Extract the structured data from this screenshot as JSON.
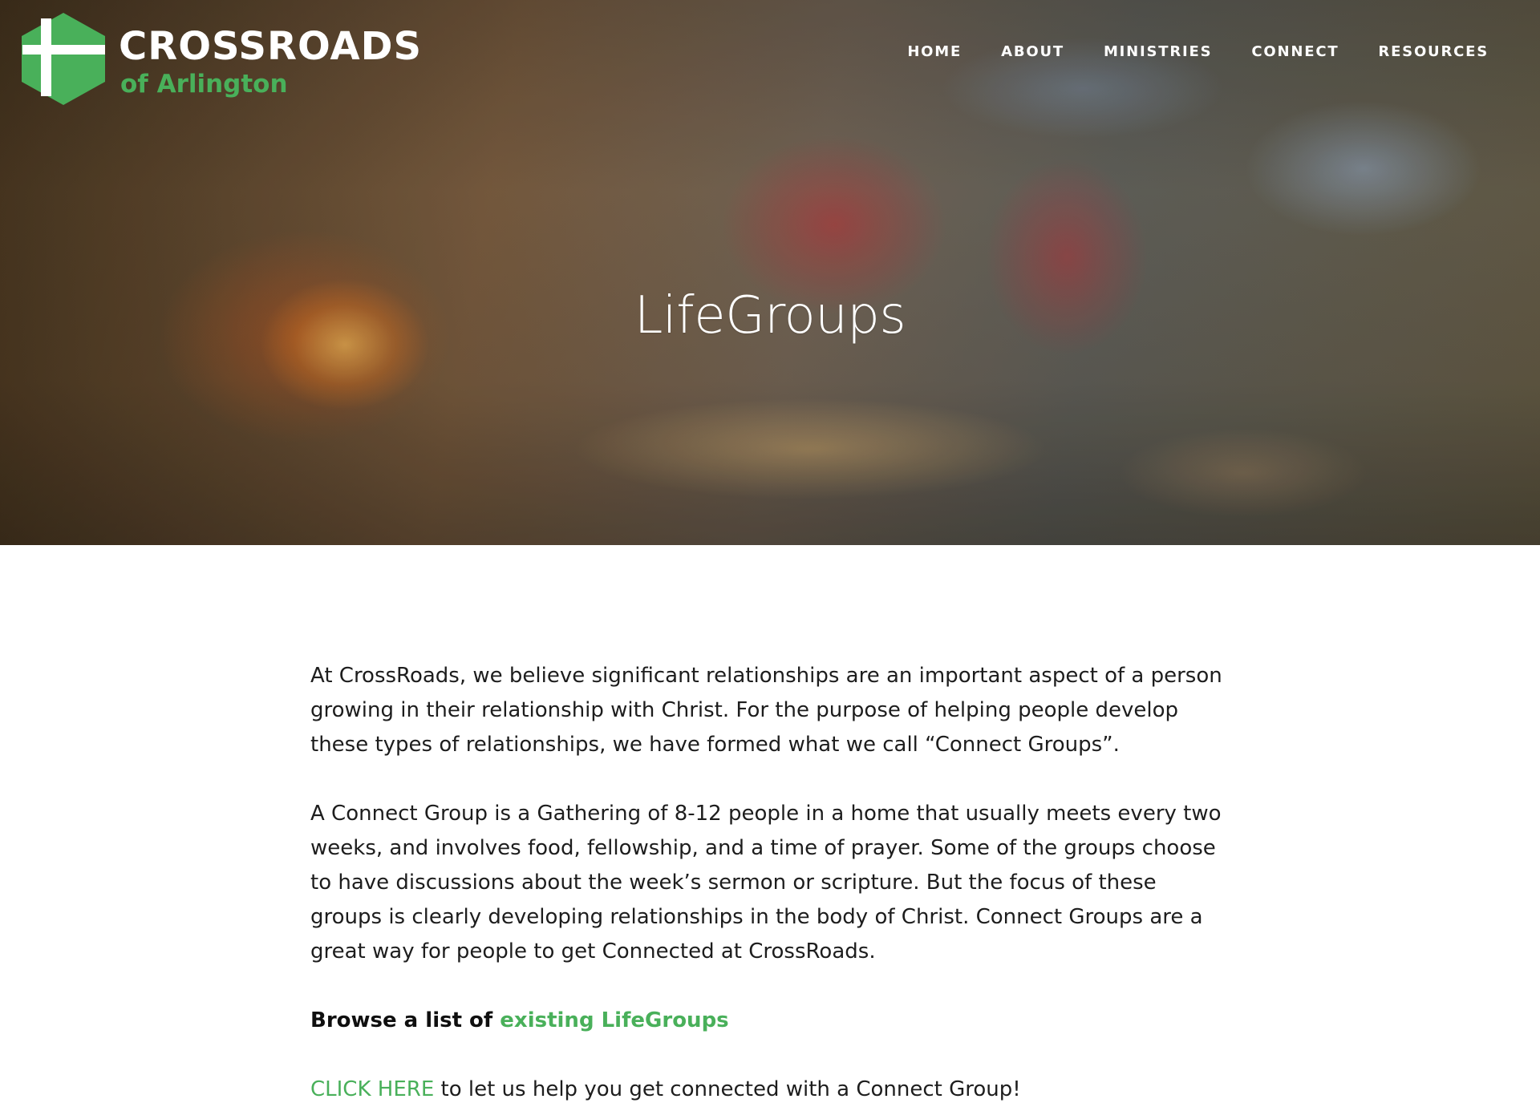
{
  "brand": {
    "title": "CROSSROADS",
    "subtitle": "of Arlington",
    "accent_color": "#49b05a",
    "logo_icon": "cross-hexagon-icon"
  },
  "navigation": {
    "items": [
      {
        "label": "HOME"
      },
      {
        "label": "ABOUT"
      },
      {
        "label": "MINISTRIES"
      },
      {
        "label": "CONNECT"
      },
      {
        "label": "RESOURCES"
      }
    ]
  },
  "hero": {
    "title": "LifeGroups"
  },
  "content": {
    "paragraph_1": "At CrossRoads, we believe significant relationships are an important aspect of a person growing in their relationship with Christ. For the purpose of helping people develop these types of relationships, we have formed what we call “Connect Groups”.",
    "paragraph_2": "A Connect Group is a Gathering of 8-12 people in a home that usually meets every two weeks, and involves food, fellowship, and a time of prayer. Some of the groups choose to have discussions about the week’s sermon or scripture. But the focus of these groups is clearly developing relationships in the body of Christ. Connect Groups are a great way for people to get Connected at CrossRoads.",
    "browse_prefix": "Browse a list of ",
    "browse_link": "existing LifeGroups",
    "click_link": "CLICK HERE",
    "click_suffix": " to let us help you get connected with a Connect Group!"
  }
}
